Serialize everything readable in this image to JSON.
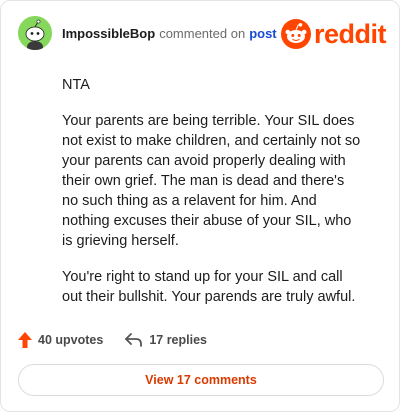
{
  "header": {
    "username": "ImpossibleBop",
    "commented_on": "commented on",
    "post_link": "post",
    "logo_text": "reddit"
  },
  "comment": {
    "paragraphs": [
      "NTA",
      "Your parents are being terrible. Your SIL does not exist to make children, and certainly not so your parents can avoid properly dealing with their own grief. The man is dead and there's no such thing as a relavent for him. And nothing excuses their abuse of your SIL, who is grieving herself.",
      "You're right to stand up for your SIL and call out their bullshit. Your parends are truly awful."
    ]
  },
  "actions": {
    "upvotes": "40 upvotes",
    "replies": "17 replies"
  },
  "view_button": "View 17 comments",
  "colors": {
    "brand": "#ff4500",
    "link": "#1a4bd6",
    "avatar_bg": "#86d85c"
  },
  "icons": [
    "snoo-avatar-icon",
    "reddit-logo-icon",
    "upvote-arrow-icon",
    "reply-arrow-icon"
  ]
}
